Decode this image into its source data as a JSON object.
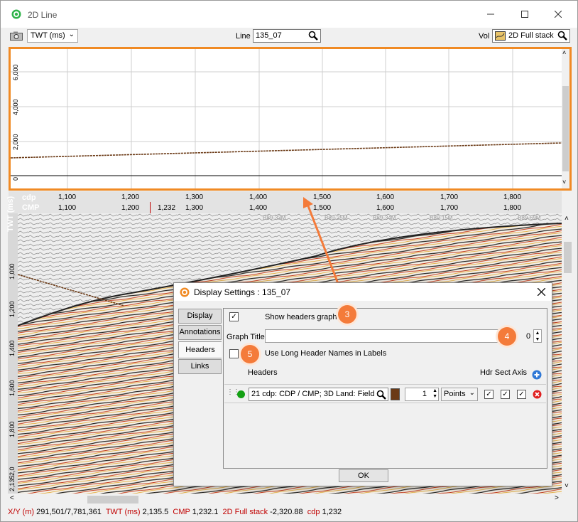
{
  "window": {
    "title": "2D Line"
  },
  "toolbar": {
    "domain_select": "TWT (ms)",
    "line_label": "Line",
    "line_value": "135_07",
    "vol_label": "Vol",
    "vol_value": "2D Full stack"
  },
  "graph": {
    "y_ticks": [
      "6,000",
      "4,000",
      "2,000",
      "0"
    ]
  },
  "axis": {
    "cdp_label": "cdp",
    "cmp_label": "CMP",
    "cdp_ticks": [
      "1,100",
      "1,200",
      "1,300",
      "1,400",
      "1,500",
      "1,600",
      "1,700",
      "1,800"
    ],
    "cmp_ticks": [
      "1,100",
      "1,200",
      "1,300",
      "1,400",
      "1,500",
      "1,600",
      "1,700",
      "1,800"
    ],
    "cursor_value": "1,232",
    "wells": [
      "B89-33M",
      "B89-25M",
      "B89-34M",
      "B89-15M",
      "B89-69M"
    ]
  },
  "twt_axis": {
    "label": "TWT (ms)",
    "ticks": [
      "1,000",
      "1,200",
      "1,400",
      "1,600",
      "1,800",
      "2,0",
      "2,135"
    ]
  },
  "status": {
    "xy_key": "X/Y (m)",
    "xy_val": "291,501/7,781,361",
    "twt_key": "TWT (ms)",
    "twt_val": "2,135.5",
    "cmp_key": "CMP",
    "cmp_val": "1,232.1",
    "vol_key": "2D Full stack",
    "vol_val": "-2,320.88",
    "cdp_key": "cdp",
    "cdp_val": "1,232"
  },
  "dialog": {
    "title": "Display Settings : 135_07",
    "tabs": [
      "Display",
      "Annotations",
      "Headers",
      "Links"
    ],
    "show_headers_label": "Show headers graph",
    "graph_title_label": "Graph Title",
    "graph_title_value": "",
    "spin_value": "0",
    "long_names_label": "Use Long Header Names in Labels",
    "headers_col": "Headers",
    "hdr_sect_axis_col": "Hdr Sect Axis",
    "row": {
      "header_name": "21 cdp: CDP / CMP; 3D Land: Field ...",
      "width_value": "1",
      "style": "Points"
    },
    "ok_label": "OK"
  },
  "callouts": [
    "3",
    "4",
    "5"
  ],
  "colors": {
    "accent": "#f08a24",
    "status_key": "#c00000",
    "line_color": "#6b3a16"
  }
}
